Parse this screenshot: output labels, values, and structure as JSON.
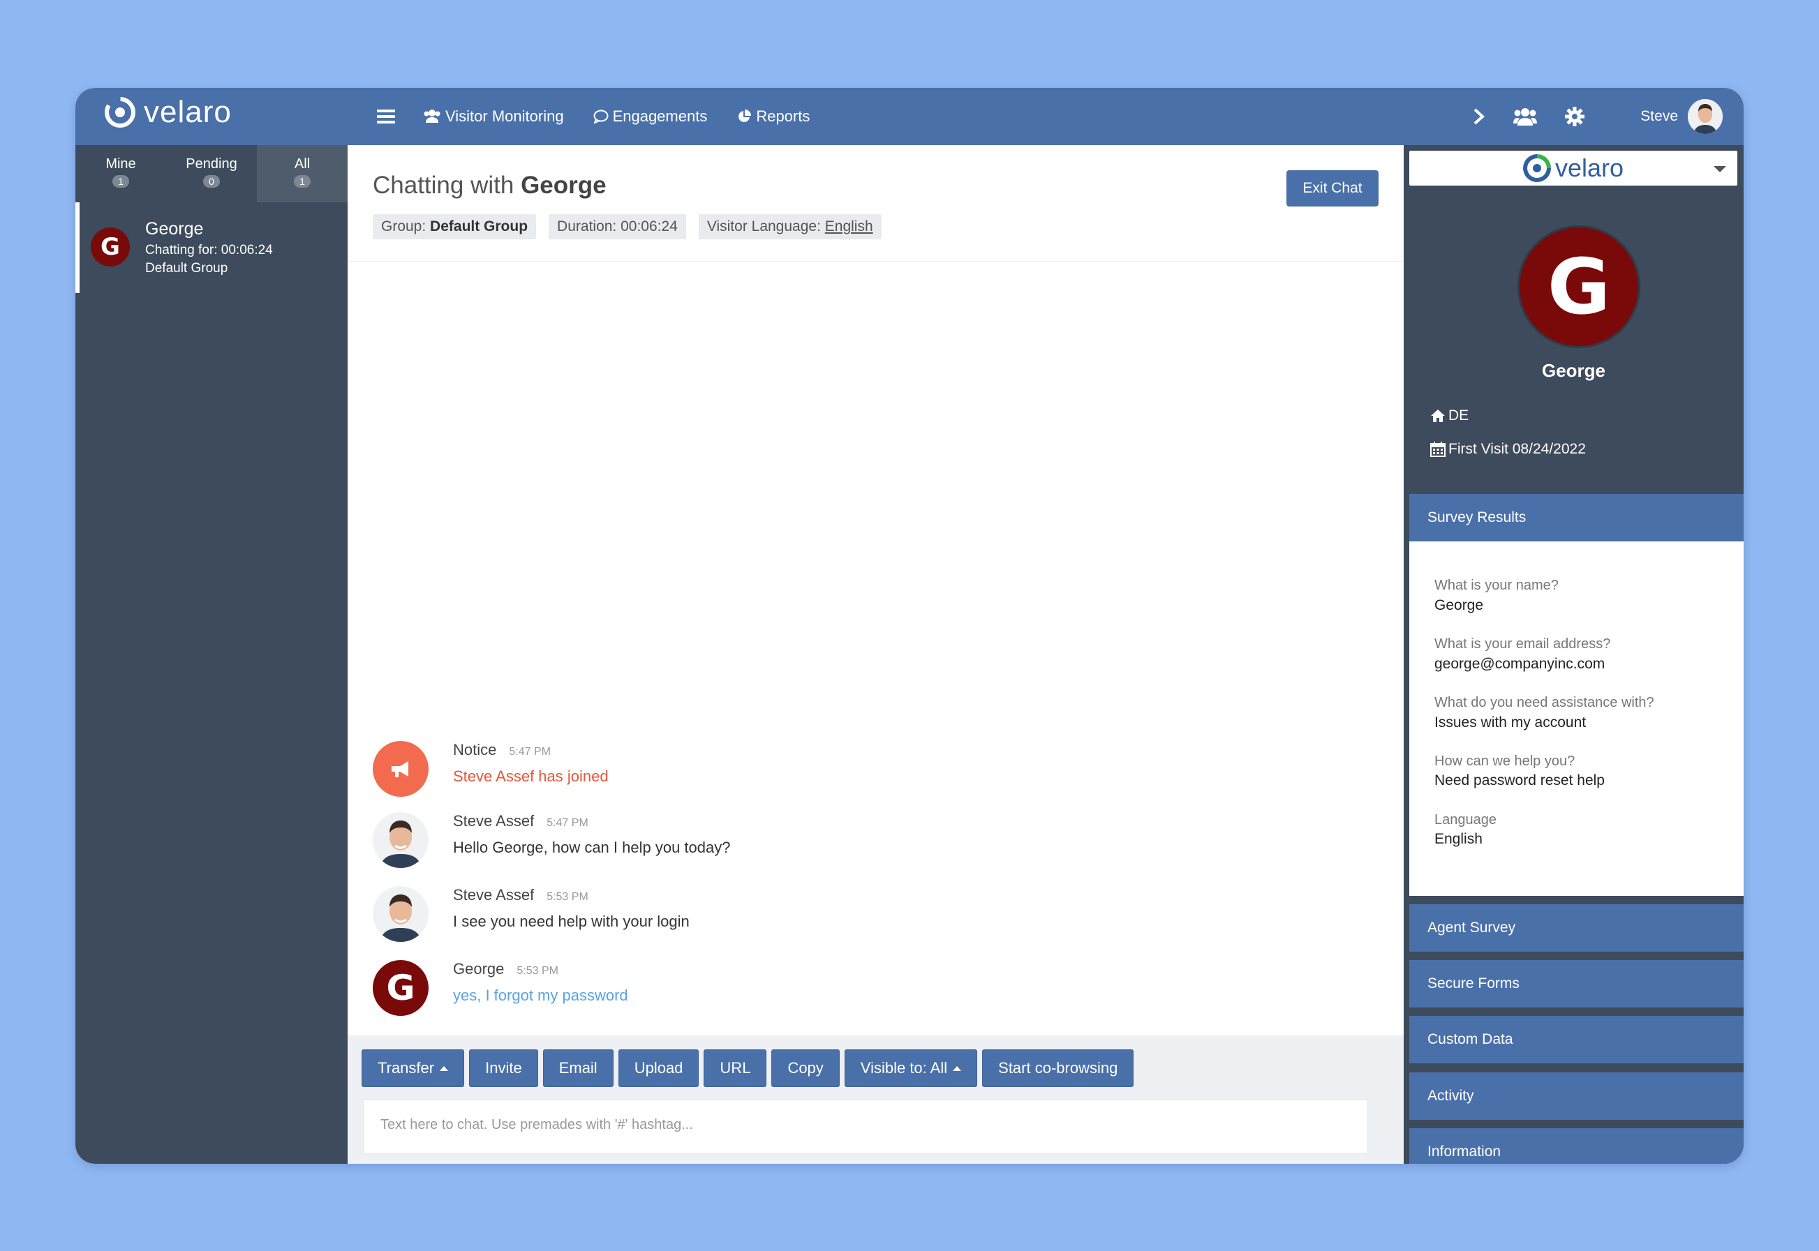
{
  "header": {
    "logo_text": "velaro",
    "nav": {
      "visitor_monitoring": "Visitor Monitoring",
      "engagements": "Engagements",
      "reports": "Reports"
    },
    "user_name": "Steve"
  },
  "left_panel": {
    "tabs": [
      {
        "label": "Mine",
        "count": "1"
      },
      {
        "label": "Pending",
        "count": "0"
      },
      {
        "label": "All",
        "count": "1"
      }
    ],
    "active_chat": {
      "initial": "G",
      "name": "George",
      "duration": "Chatting for: 00:06:24",
      "group": "Default Group"
    }
  },
  "chat": {
    "title_prefix": "Chatting with",
    "visitor_name": "George",
    "exit_label": "Exit Chat",
    "group_label": "Group:",
    "group_value": "Default Group",
    "duration": "Duration: 00:06:24",
    "language_label": "Visitor Language:",
    "language_value": "English",
    "messages": [
      {
        "sender": "Notice",
        "time": "5:47 PM",
        "text": "Steve Assef has joined"
      },
      {
        "sender": "Steve Assef",
        "time": "5:47 PM",
        "text": "Hello George, how can I help you today?"
      },
      {
        "sender": "Steve Assef",
        "time": "5:53 PM",
        "text": "I see you need help with your login"
      },
      {
        "sender": "George",
        "time": "5:53 PM",
        "text": "yes, I forgot my password"
      }
    ],
    "toolbar": {
      "transfer": "Transfer",
      "invite": "Invite",
      "email": "Email",
      "upload": "Upload",
      "url": "URL",
      "copy": "Copy",
      "visible_to": "Visible to: All",
      "cobrowse": "Start co-browsing"
    },
    "input_placeholder": "Text here to chat. Use premades with '#' hashtag..."
  },
  "right_panel": {
    "brand": "velaro",
    "visitor_initial": "G",
    "visitor_name": "George",
    "country": "DE",
    "first_visit": "First Visit 08/24/2022",
    "survey_title": "Survey Results",
    "survey": [
      {
        "q": "What is your name?",
        "a": "George"
      },
      {
        "q": "What is your email address?",
        "a": "george@companyinc.com"
      },
      {
        "q": "What do you need assistance with?",
        "a": "Issues with my account"
      },
      {
        "q": "How can we help you?",
        "a": "Need password reset help"
      },
      {
        "q": "Language",
        "a": "English"
      }
    ],
    "sections": [
      "Agent Survey",
      "Secure Forms",
      "Custom Data",
      "Activity",
      "Information"
    ]
  },
  "colors": {
    "page_bg": "#8fb8f3",
    "header_blue": "#4a70aa",
    "sidebar_dark": "#3d4b5c",
    "avatar_red": "#7a0a0a",
    "notice_orange": "#f26b4e",
    "visitor_text": "#5aa3e0"
  }
}
